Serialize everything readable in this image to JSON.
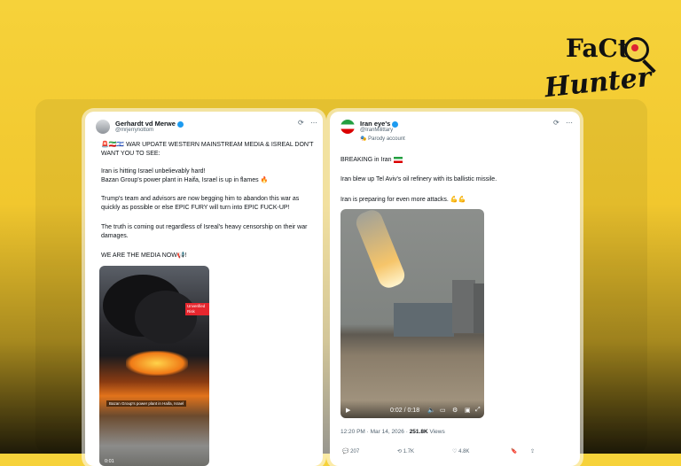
{
  "logo": {
    "line1": "FaCt",
    "line2": "Hunter"
  },
  "tweet_left": {
    "name": "Gerhardt vd Merwe",
    "handle": "@mrjerrynottom",
    "line1": "🚨🇮🇷🇮🇱 WAR UPDATE WESTERN MAINSTREAM MEDIA & ISREAL DON'T WANT YOU TO SEE:",
    "para1a": "Iran is hitting Israel unbelievably hard!",
    "para1b": "Bazan Group's power plant in Haifa, Israel is up in flames 🔥",
    "para2": "Trump's team and advisors are now begging him to abandon this war as quickly as possible or else EPIC FURY will turn into EPIC FUCK-UP!",
    "para3": "The truth is coming out regardless of Isreal's heavy censorship on their war damages.",
    "para4": "WE ARE THE MEDIA NOW📢!",
    "media_tag": "Unverified Risk",
    "media_caption": "Bazan Group's power plant in Haifa, Israel",
    "media_time": "0:01"
  },
  "tweet_right": {
    "name": "Iran eye's",
    "handle": "@IranMilittary",
    "badge": "Parody account",
    "line1": "BREAKING in Iran",
    "line2": "Iran blew up Tel Aviv's oil refinery with its ballistic missile.",
    "line3": "Iran is preparing for even more attacks. 💪💪",
    "video_time": "0:02 / 0:18",
    "timestamp": "12:20 PM · Mar 14, 2026 ·",
    "views_count": "251.8K",
    "views_label": "Views",
    "action_replies": "207",
    "action_reposts": "1.7K",
    "action_likes": "4.8K"
  },
  "colors": {
    "background": "#f3cd35",
    "accent": "#1d9bf0"
  }
}
